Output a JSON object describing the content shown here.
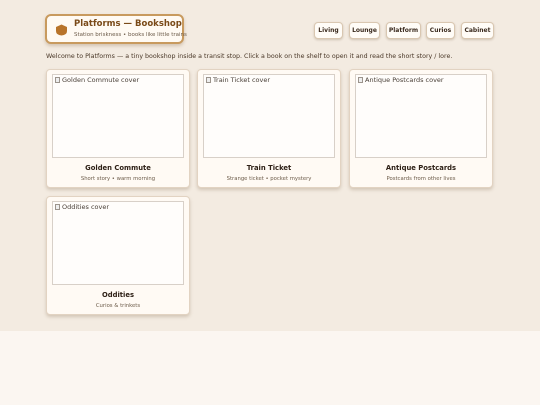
{
  "brand": {
    "title": "Platforms — Bookshop",
    "subtitle": "Station briskness • books like little trains",
    "icon": "shield-badge-icon",
    "accent": "#c89a5e"
  },
  "nav": [
    "Living",
    "Lounge",
    "Platform",
    "Curios",
    "Cabinet"
  ],
  "intro": "Welcome to Platforms — a tiny bookshop inside a transit stop. Click a book on the shelf to open it and read the short story / lore.",
  "books": [
    {
      "cover_alt": "Golden Commute cover",
      "title": "Golden Commute",
      "subtitle": "Short story • warm morning"
    },
    {
      "cover_alt": "Train Ticket cover",
      "title": "Train Ticket",
      "subtitle": "Strange ticket • pocket mystery"
    },
    {
      "cover_alt": "Antique Postcards cover",
      "title": "Antique Postcards",
      "subtitle": "Postcards from other lives"
    },
    {
      "cover_alt": "Oddities cover",
      "title": "Oddities",
      "subtitle": "Curios & trinkets"
    }
  ]
}
